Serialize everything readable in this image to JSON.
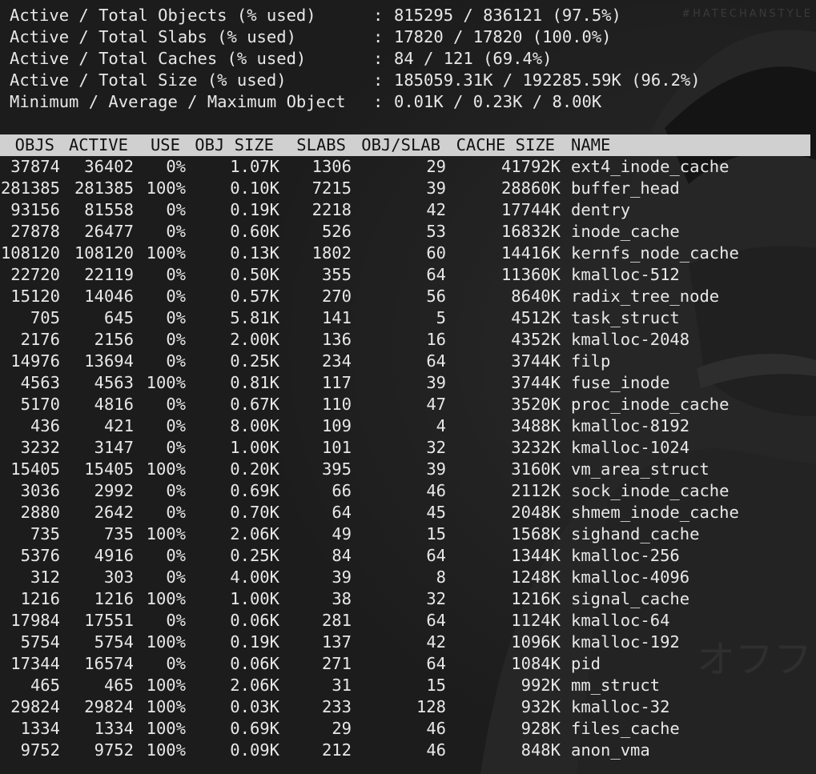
{
  "watermark": "#HATECHANSTYLE",
  "summary": [
    {
      "label": "Active / Total Objects (% used)",
      "value": "815295 / 836121 (97.5%)"
    },
    {
      "label": "Active / Total Slabs (% used)",
      "value": "17820 / 17820 (100.0%)"
    },
    {
      "label": "Active / Total Caches (% used)",
      "value": "84 / 121 (69.4%)"
    },
    {
      "label": "Active / Total Size (% used)",
      "value": "185059.31K / 192285.59K (96.2%)"
    },
    {
      "label": "Minimum / Average / Maximum Object",
      "value": "0.01K / 0.23K / 8.00K"
    }
  ],
  "summary_separator": ":",
  "header": {
    "objs": "OBJS",
    "active": "ACTIVE",
    "use": "USE",
    "obj_size": "OBJ SIZE",
    "slabs": "SLABS",
    "obj_slab": "OBJ/SLAB",
    "cache_size": "CACHE SIZE",
    "name": "NAME"
  },
  "rows": [
    {
      "objs": "37874",
      "active": "36402",
      "use": "0%",
      "obj_size": "1.07K",
      "slabs": "1306",
      "obj_slab": "29",
      "cache_size": "41792K",
      "name": "ext4_inode_cache"
    },
    {
      "objs": "281385",
      "active": "281385",
      "use": "100%",
      "obj_size": "0.10K",
      "slabs": "7215",
      "obj_slab": "39",
      "cache_size": "28860K",
      "name": "buffer_head"
    },
    {
      "objs": "93156",
      "active": "81558",
      "use": "0%",
      "obj_size": "0.19K",
      "slabs": "2218",
      "obj_slab": "42",
      "cache_size": "17744K",
      "name": "dentry"
    },
    {
      "objs": "27878",
      "active": "26477",
      "use": "0%",
      "obj_size": "0.60K",
      "slabs": "526",
      "obj_slab": "53",
      "cache_size": "16832K",
      "name": "inode_cache"
    },
    {
      "objs": "108120",
      "active": "108120",
      "use": "100%",
      "obj_size": "0.13K",
      "slabs": "1802",
      "obj_slab": "60",
      "cache_size": "14416K",
      "name": "kernfs_node_cache"
    },
    {
      "objs": "22720",
      "active": "22119",
      "use": "0%",
      "obj_size": "0.50K",
      "slabs": "355",
      "obj_slab": "64",
      "cache_size": "11360K",
      "name": "kmalloc-512"
    },
    {
      "objs": "15120",
      "active": "14046",
      "use": "0%",
      "obj_size": "0.57K",
      "slabs": "270",
      "obj_slab": "56",
      "cache_size": "8640K",
      "name": "radix_tree_node"
    },
    {
      "objs": "705",
      "active": "645",
      "use": "0%",
      "obj_size": "5.81K",
      "slabs": "141",
      "obj_slab": "5",
      "cache_size": "4512K",
      "name": "task_struct"
    },
    {
      "objs": "2176",
      "active": "2156",
      "use": "0%",
      "obj_size": "2.00K",
      "slabs": "136",
      "obj_slab": "16",
      "cache_size": "4352K",
      "name": "kmalloc-2048"
    },
    {
      "objs": "14976",
      "active": "13694",
      "use": "0%",
      "obj_size": "0.25K",
      "slabs": "234",
      "obj_slab": "64",
      "cache_size": "3744K",
      "name": "filp"
    },
    {
      "objs": "4563",
      "active": "4563",
      "use": "100%",
      "obj_size": "0.81K",
      "slabs": "117",
      "obj_slab": "39",
      "cache_size": "3744K",
      "name": "fuse_inode"
    },
    {
      "objs": "5170",
      "active": "4816",
      "use": "0%",
      "obj_size": "0.67K",
      "slabs": "110",
      "obj_slab": "47",
      "cache_size": "3520K",
      "name": "proc_inode_cache"
    },
    {
      "objs": "436",
      "active": "421",
      "use": "0%",
      "obj_size": "8.00K",
      "slabs": "109",
      "obj_slab": "4",
      "cache_size": "3488K",
      "name": "kmalloc-8192"
    },
    {
      "objs": "3232",
      "active": "3147",
      "use": "0%",
      "obj_size": "1.00K",
      "slabs": "101",
      "obj_slab": "32",
      "cache_size": "3232K",
      "name": "kmalloc-1024"
    },
    {
      "objs": "15405",
      "active": "15405",
      "use": "100%",
      "obj_size": "0.20K",
      "slabs": "395",
      "obj_slab": "39",
      "cache_size": "3160K",
      "name": "vm_area_struct"
    },
    {
      "objs": "3036",
      "active": "2992",
      "use": "0%",
      "obj_size": "0.69K",
      "slabs": "66",
      "obj_slab": "46",
      "cache_size": "2112K",
      "name": "sock_inode_cache"
    },
    {
      "objs": "2880",
      "active": "2642",
      "use": "0%",
      "obj_size": "0.70K",
      "slabs": "64",
      "obj_slab": "45",
      "cache_size": "2048K",
      "name": "shmem_inode_cache"
    },
    {
      "objs": "735",
      "active": "735",
      "use": "100%",
      "obj_size": "2.06K",
      "slabs": "49",
      "obj_slab": "15",
      "cache_size": "1568K",
      "name": "sighand_cache"
    },
    {
      "objs": "5376",
      "active": "4916",
      "use": "0%",
      "obj_size": "0.25K",
      "slabs": "84",
      "obj_slab": "64",
      "cache_size": "1344K",
      "name": "kmalloc-256"
    },
    {
      "objs": "312",
      "active": "303",
      "use": "0%",
      "obj_size": "4.00K",
      "slabs": "39",
      "obj_slab": "8",
      "cache_size": "1248K",
      "name": "kmalloc-4096"
    },
    {
      "objs": "1216",
      "active": "1216",
      "use": "100%",
      "obj_size": "1.00K",
      "slabs": "38",
      "obj_slab": "32",
      "cache_size": "1216K",
      "name": "signal_cache"
    },
    {
      "objs": "17984",
      "active": "17551",
      "use": "0%",
      "obj_size": "0.06K",
      "slabs": "281",
      "obj_slab": "64",
      "cache_size": "1124K",
      "name": "kmalloc-64"
    },
    {
      "objs": "5754",
      "active": "5754",
      "use": "100%",
      "obj_size": "0.19K",
      "slabs": "137",
      "obj_slab": "42",
      "cache_size": "1096K",
      "name": "kmalloc-192"
    },
    {
      "objs": "17344",
      "active": "16574",
      "use": "0%",
      "obj_size": "0.06K",
      "slabs": "271",
      "obj_slab": "64",
      "cache_size": "1084K",
      "name": "pid"
    },
    {
      "objs": "465",
      "active": "465",
      "use": "100%",
      "obj_size": "2.06K",
      "slabs": "31",
      "obj_slab": "15",
      "cache_size": "992K",
      "name": "mm_struct"
    },
    {
      "objs": "29824",
      "active": "29824",
      "use": "100%",
      "obj_size": "0.03K",
      "slabs": "233",
      "obj_slab": "128",
      "cache_size": "932K",
      "name": "kmalloc-32"
    },
    {
      "objs": "1334",
      "active": "1334",
      "use": "100%",
      "obj_size": "0.69K",
      "slabs": "29",
      "obj_slab": "46",
      "cache_size": "928K",
      "name": "files_cache"
    },
    {
      "objs": "9752",
      "active": "9752",
      "use": "100%",
      "obj_size": "0.09K",
      "slabs": "212",
      "obj_slab": "46",
      "cache_size": "848K",
      "name": "anon_vma"
    }
  ],
  "colors": {
    "background": "#1c1c1c",
    "text": "#e8e8e8",
    "header_bg": "#d0d0d0",
    "header_text": "#111111"
  }
}
